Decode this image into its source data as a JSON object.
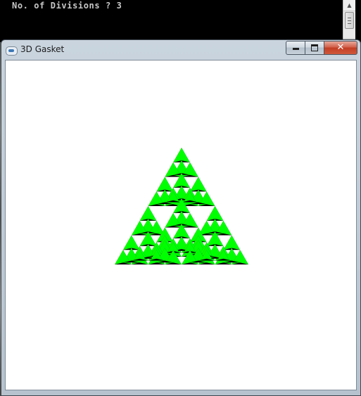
{
  "console": {
    "prompt_text": "No. of Divisions ? 3"
  },
  "scrollbar": {
    "up_arrow_icon": "triangle-up"
  },
  "window": {
    "title": "3D Gasket",
    "app_icon": "opengl-app-icon",
    "minimize_icon": "minimize-icon",
    "maximize_icon": "maximize-icon",
    "close_label": "✕"
  },
  "gasket": {
    "divisions": 3,
    "face_colors": [
      "#ff0000",
      "#00ff00",
      "#0000ff",
      "#000000"
    ],
    "background": "#ffffff"
  }
}
